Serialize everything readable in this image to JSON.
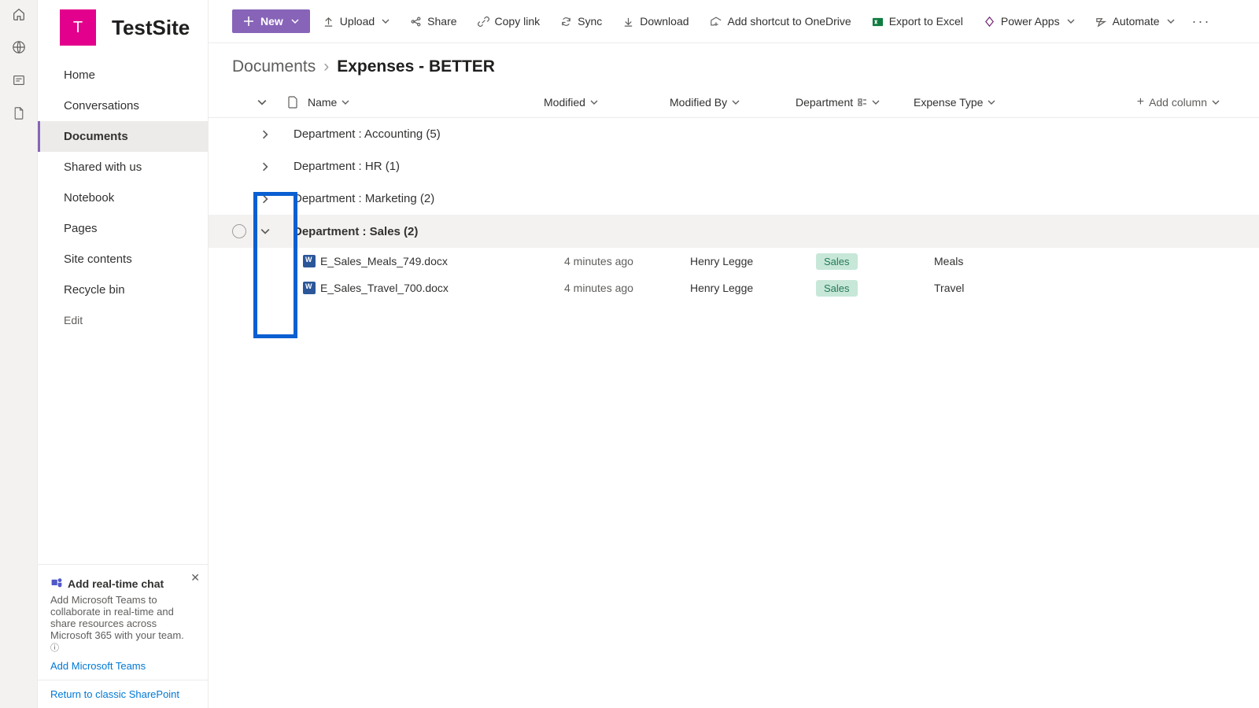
{
  "site": {
    "tile_letter": "T",
    "title": "TestSite"
  },
  "nav": {
    "items": [
      {
        "label": "Home"
      },
      {
        "label": "Conversations"
      },
      {
        "label": "Documents"
      },
      {
        "label": "Shared with us"
      },
      {
        "label": "Notebook"
      },
      {
        "label": "Pages"
      },
      {
        "label": "Site contents"
      },
      {
        "label": "Recycle bin"
      }
    ],
    "edit_label": "Edit"
  },
  "chat_card": {
    "title": "Add real-time chat",
    "body": "Add Microsoft Teams to collaborate in real-time and share resources across Microsoft 365 with your team.",
    "link": "Add Microsoft Teams"
  },
  "classic_link": "Return to classic SharePoint",
  "cmdbar": {
    "new": "New",
    "upload": "Upload",
    "share": "Share",
    "copylink": "Copy link",
    "sync": "Sync",
    "download": "Download",
    "shortcut": "Add shortcut to OneDrive",
    "export": "Export to Excel",
    "powerapps": "Power Apps",
    "automate": "Automate"
  },
  "breadcrumb": {
    "root": "Documents",
    "leaf": "Expenses - BETTER"
  },
  "columns": {
    "name": "Name",
    "modified": "Modified",
    "modified_by": "Modified By",
    "department": "Department",
    "expense_type": "Expense Type",
    "add": "Add column"
  },
  "groups": [
    {
      "label": "Department : Accounting (5)",
      "expanded": false
    },
    {
      "label": "Department : HR (1)",
      "expanded": false
    },
    {
      "label": "Department : Marketing (2)",
      "expanded": false
    },
    {
      "label": "Department : Sales (2)",
      "expanded": true
    }
  ],
  "rows": [
    {
      "name": "E_Sales_Meals_749.docx",
      "modified": "4 minutes ago",
      "by": "Henry Legge",
      "dept": "Sales",
      "exp": "Meals"
    },
    {
      "name": "E_Sales_Travel_700.docx",
      "modified": "4 minutes ago",
      "by": "Henry Legge",
      "dept": "Sales",
      "exp": "Travel"
    }
  ]
}
